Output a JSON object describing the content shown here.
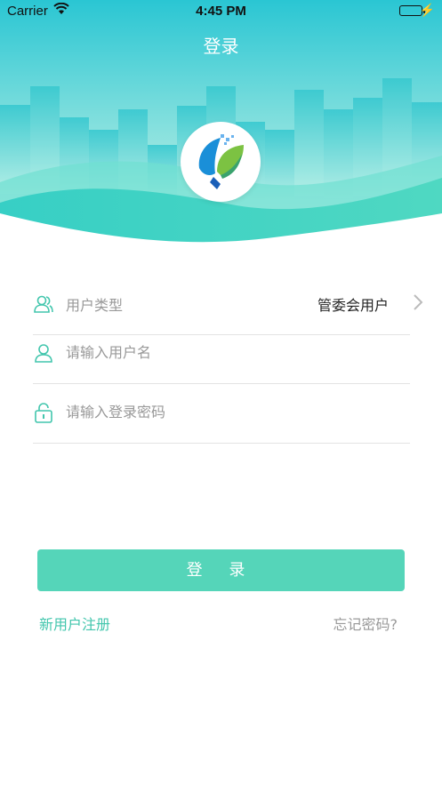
{
  "status_bar": {
    "carrier": "Carrier",
    "time": "4:45 PM"
  },
  "header": {
    "title": "登录"
  },
  "form": {
    "user_type_label": "用户类型",
    "user_type_value": "管委会用户",
    "username_placeholder": "请输入用户名",
    "password_placeholder": "请输入登录密码"
  },
  "login_button": "登 录",
  "links": {
    "register": "新用户注册",
    "forgot": "忘记密码?"
  },
  "colors": {
    "accent": "#55d5b9",
    "teal": "#2ccfcf",
    "link": "#42c6ad"
  }
}
